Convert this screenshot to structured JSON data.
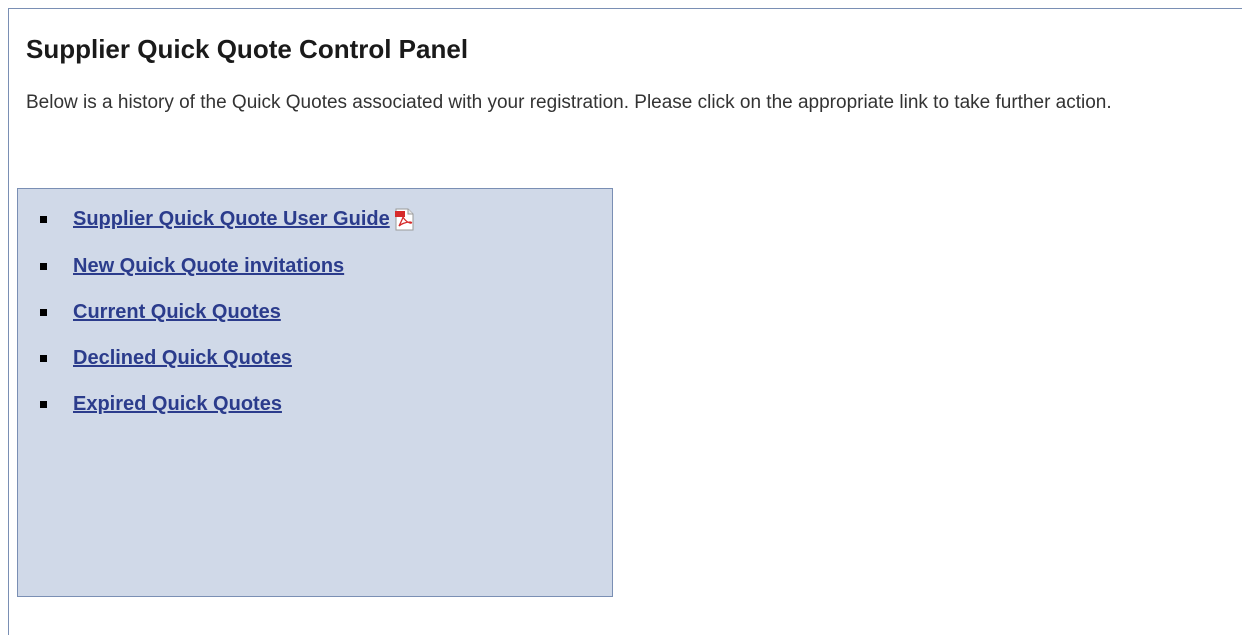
{
  "page": {
    "title": "Supplier Quick Quote Control Panel",
    "intro": "Below is a history of the Quick Quotes associated with your registration. Please click on the appropriate link to take further action."
  },
  "panel": {
    "items": [
      {
        "label": "Supplier Quick Quote User Guide",
        "icon": "pdf-icon"
      },
      {
        "label": "New Quick Quote invitations"
      },
      {
        "label": "Current Quick Quotes"
      },
      {
        "label": "Declined Quick Quotes"
      },
      {
        "label": "Expired Quick Quotes"
      }
    ]
  },
  "colors": {
    "link": "#2b3c8c",
    "panel_background": "#d0d9e8",
    "panel_border": "#7a8fb4"
  }
}
